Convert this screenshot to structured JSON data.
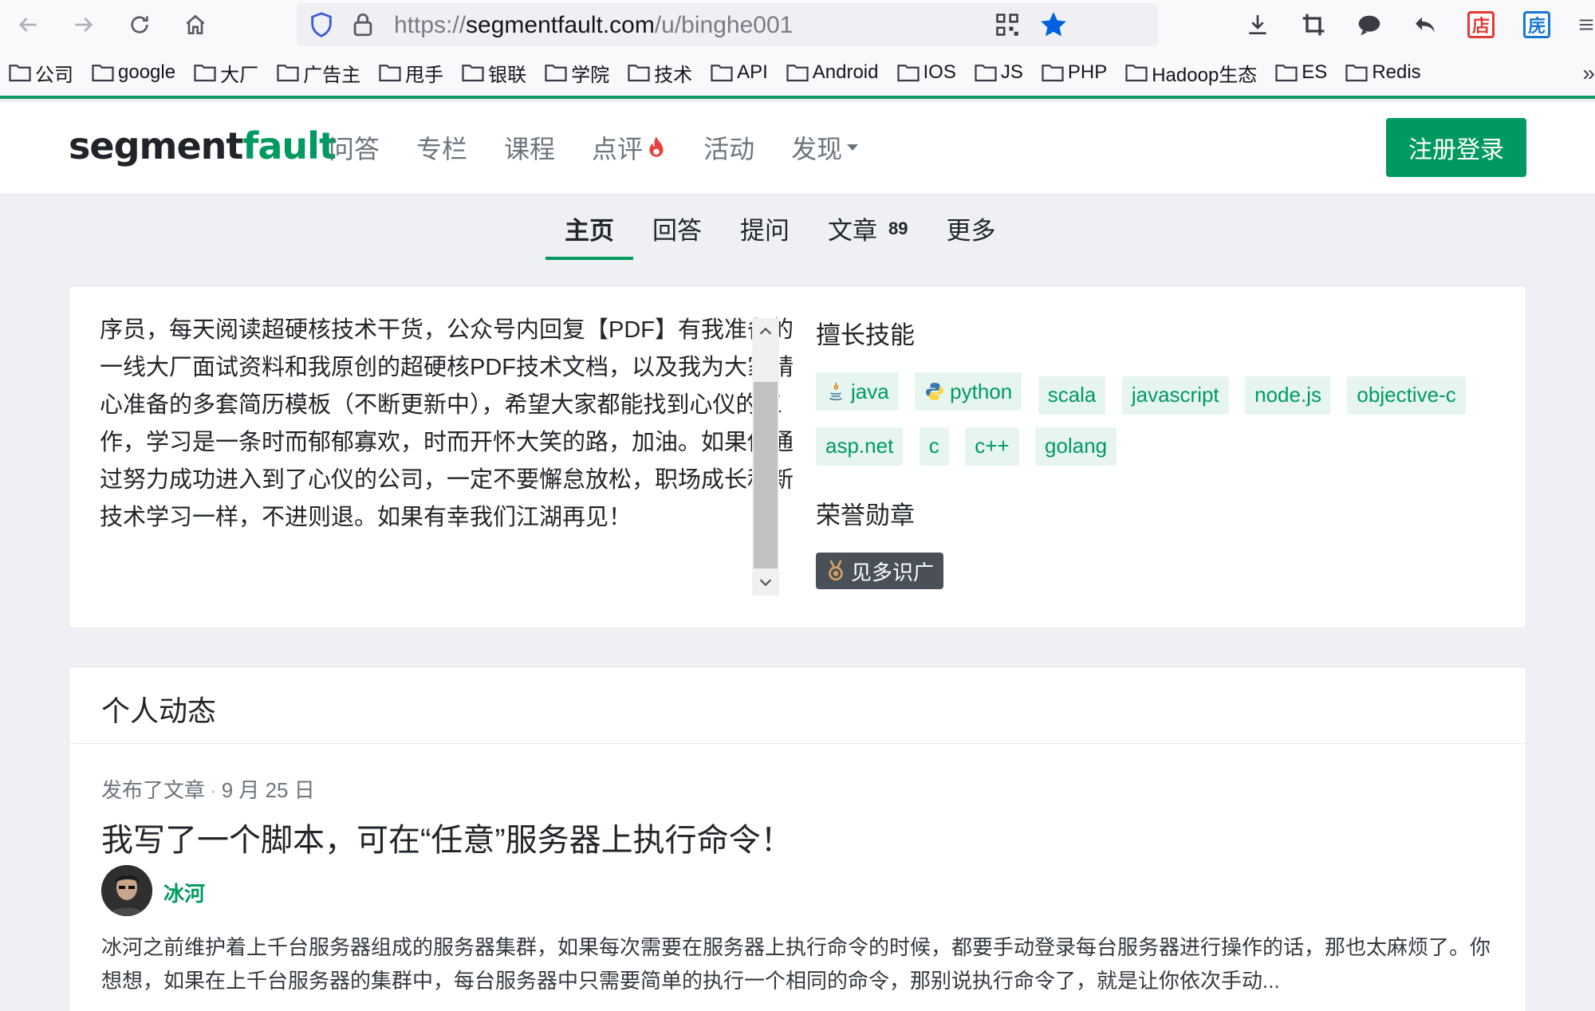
{
  "browser": {
    "url_prefix": "https://",
    "url_domain": "segmentfault.com",
    "url_path": "/u/binghe001",
    "ext_red_label": "店",
    "ext_blue_label": "庑",
    "bookmarks": [
      "公司",
      "google",
      "大厂",
      "广告主",
      "甩手",
      "银联",
      "学院",
      "技术",
      "API",
      "Android",
      "IOS",
      "JS",
      "PHP",
      "Hadoop生态",
      "ES",
      "Redis"
    ],
    "bookmarks_overflow": "»"
  },
  "site": {
    "logo_part1": "segment",
    "logo_part2": "fault",
    "nav": [
      "问答",
      "专栏",
      "课程",
      "点评",
      "活动",
      "发现"
    ],
    "login_label": "注册登录"
  },
  "tabs": [
    {
      "label": "主页",
      "active": true
    },
    {
      "label": "回答"
    },
    {
      "label": "提问"
    },
    {
      "label": "文章",
      "count": "89"
    },
    {
      "label": "更多"
    }
  ],
  "about": {
    "bio": "序员，每天阅读超硬核技术干货，公众号内回复【PDF】有我准备的一线大厂面试资料和我原创的超硬核PDF技术文档，以及我为大家精心准备的多套简历模板（不断更新中），希望大家都能找到心仪的工作，学习是一条时而郁郁寡欢，时而开怀大笑的路，加油。如果你通过努力成功进入到了心仪的公司，一定不要懈怠放松，职场成长和新技术学习一样，不进则退。如果有幸我们江湖再见！",
    "skills_title": "擅长技能",
    "skills": [
      "java",
      "python",
      "scala",
      "javascript",
      "node.js",
      "objective-c",
      "asp.net",
      "c",
      "c++",
      "golang"
    ],
    "honors_title": "荣誉勋章",
    "badge": "见多识广"
  },
  "activity": {
    "title": "个人动态",
    "meta_action": "发布了文章",
    "meta_sep": "·",
    "meta_date": "9 月 25 日",
    "post_title": "我写了一个脚本，可在“任意”服务器上执行命令！",
    "author": "冰河",
    "excerpt": "冰河之前维护着上千台服务器组成的服务器集群，如果每次需要在服务器上执行命令的时候，都要手动登录每台服务器进行操作的话，那也太麻烦了。你想想，如果在上千台服务器的集群中，每台服务器中只需要简单的执行一个相同的命令，那别说执行命令了，就是让你依次手动..."
  },
  "colors": {
    "brand": "#009a61",
    "skill_bg": "#e6f5ef",
    "badge_bg": "#495057"
  }
}
